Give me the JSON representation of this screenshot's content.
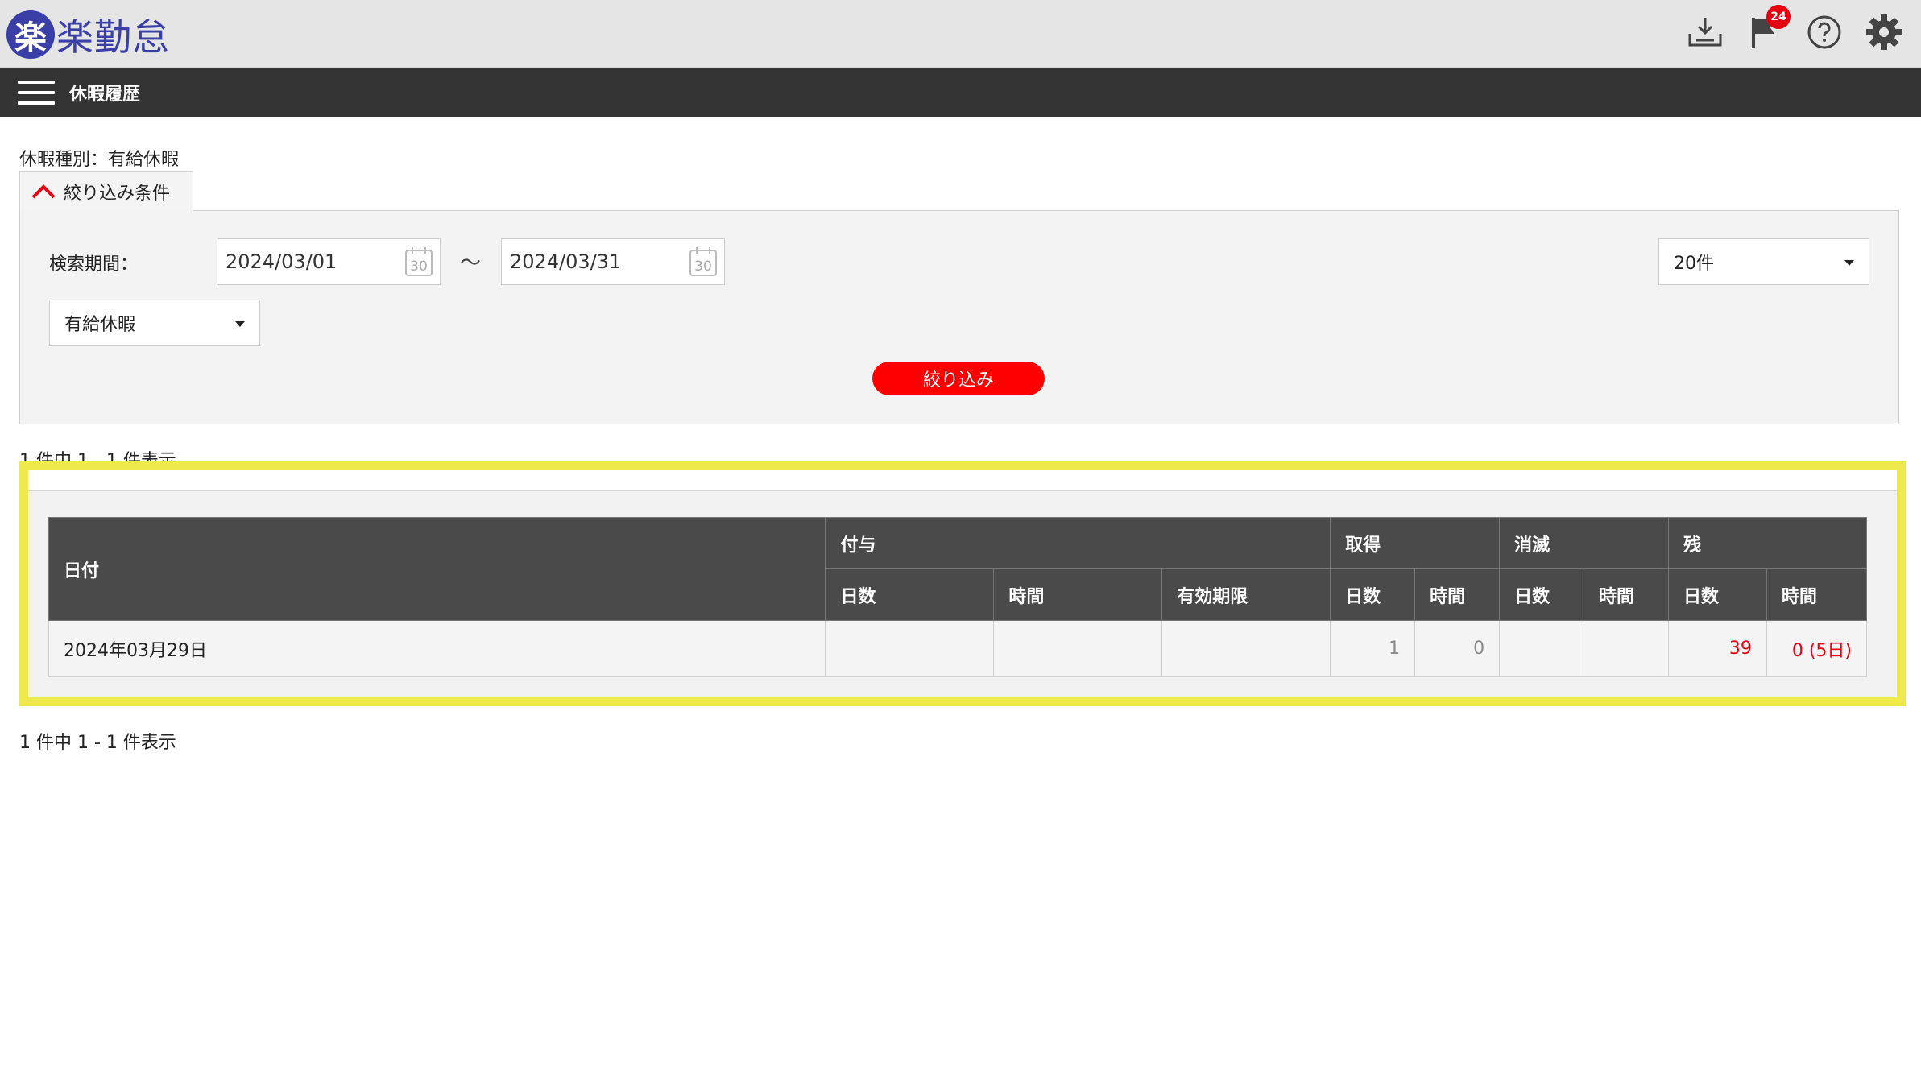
{
  "header": {
    "logo_mark": "楽",
    "logo_text": "楽勤怠",
    "notification_count": "24"
  },
  "menubar": {
    "title": "休暇履歴"
  },
  "page": {
    "leave_type_label": "休暇種別：有給休暇"
  },
  "filter": {
    "tab_label": "絞り込み条件",
    "period_label": "検索期間：",
    "date_from": "2024/03/01",
    "date_to": "2024/03/31",
    "calendar_icon_text": "30",
    "separator": "〜",
    "leave_type_selected": "有給休暇",
    "page_size_selected": "20件",
    "submit_label": "絞り込み"
  },
  "result": {
    "count_text": "1 件中 1 - 1 件表示"
  },
  "table": {
    "headers": {
      "date": "日付",
      "grant": "付与",
      "acquired": "取得",
      "expired": "消滅",
      "remaining": "残",
      "days": "日数",
      "hours": "時間",
      "expiry": "有効期限"
    },
    "rows": [
      {
        "date": "2024年03月29日",
        "grant_days": "",
        "grant_hours": "",
        "grant_expiry": "",
        "acquired_days": "1",
        "acquired_hours": "0",
        "expired_days": "",
        "expired_hours": "",
        "remaining_days": "39",
        "remaining_hours": "0 (5日)"
      }
    ]
  },
  "colors": {
    "brand_blue": "#3a3fa8",
    "accent_red": "#e60012",
    "highlight_yellow": "#eeea4c",
    "menubar_bg": "#333333"
  }
}
